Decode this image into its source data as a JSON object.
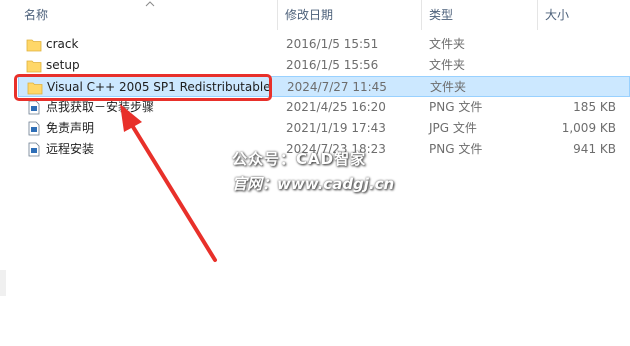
{
  "header": {
    "col_name": "名称",
    "col_date": "修改日期",
    "col_type": "类型",
    "col_size": "大小",
    "sort_icon": "chevron-up-icon"
  },
  "files": [
    {
      "name": "crack",
      "date": "2016/1/5 15:51",
      "type": "文件夹",
      "size": "",
      "icon": "folder-icon"
    },
    {
      "name": "setup",
      "date": "2016/1/5 15:56",
      "type": "文件夹",
      "size": "",
      "icon": "folder-icon"
    },
    {
      "name": "Visual C++ 2005 SP1 Redistributable",
      "date": "2024/7/27 11:45",
      "type": "文件夹",
      "size": "",
      "icon": "folder-icon",
      "selected": true
    },
    {
      "name": "点我获取－安装步骤",
      "date": "2021/4/25 16:20",
      "type": "PNG 文件",
      "size": "185 KB",
      "icon": "image-file-icon"
    },
    {
      "name": "免责声明",
      "date": "2021/1/19 17:43",
      "type": "JPG 文件",
      "size": "1,009 KB",
      "icon": "image-file-icon"
    },
    {
      "name": "远程安装",
      "date": "2024/7/23 18:23",
      "type": "PNG 文件",
      "size": "941 KB",
      "icon": "image-file-icon"
    }
  ],
  "watermark": {
    "line1": "公众号：CAD智家",
    "line2": "官网：www.cadgj.cn"
  },
  "colors": {
    "selected_bg": "#cce8ff",
    "selected_border": "#99d1ff",
    "annotation_red": "#e8302a",
    "folder_yellow": "#ffd768"
  }
}
